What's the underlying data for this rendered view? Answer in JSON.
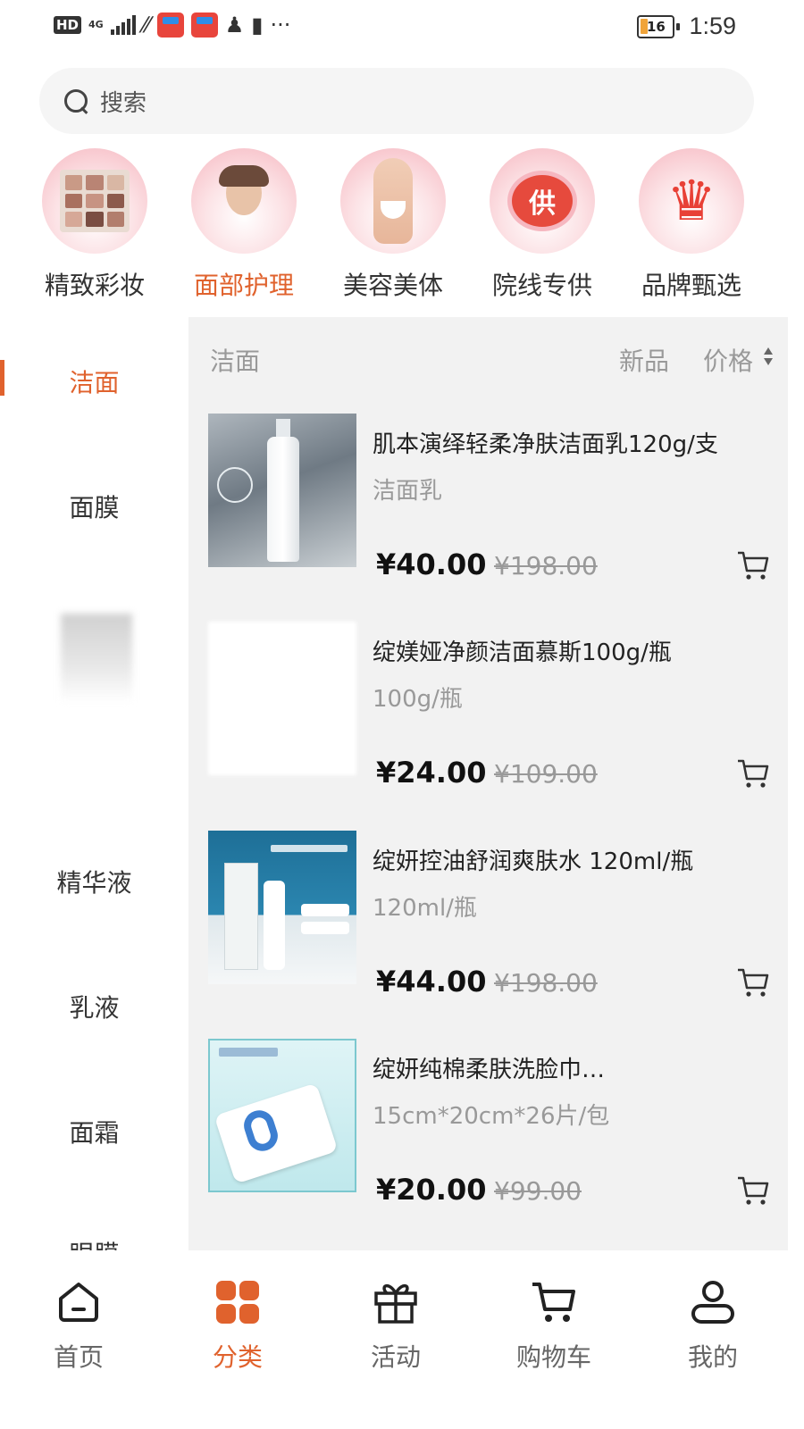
{
  "status_bar": {
    "hd": "HD",
    "network": "4G",
    "battery": "16",
    "time": "1:59",
    "more": "···"
  },
  "search": {
    "placeholder": "搜索"
  },
  "categories": [
    {
      "label": "精致彩妆",
      "icon": "eyeshadow-palette-icon",
      "active": false
    },
    {
      "label": "面部护理",
      "icon": "face-care-icon",
      "active": true
    },
    {
      "label": "美容美体",
      "icon": "body-care-icon",
      "active": false
    },
    {
      "label": "院线专供",
      "icon": "supply-badge-icon",
      "active": false
    },
    {
      "label": "品牌甄选",
      "icon": "crown-icon",
      "active": false
    }
  ],
  "supply_badge_text": "供",
  "left_nav": {
    "items": [
      "洁面",
      "面膜",
      "眼霜",
      "精华液",
      "乳液",
      "面霜",
      "眼膜"
    ],
    "active_index": 0
  },
  "filter": {
    "category": "洁面",
    "new_label": "新品",
    "price_label": "价格"
  },
  "products": [
    {
      "title": "肌本演绎轻柔净肤洁面乳120g/支",
      "spec": "洁面乳",
      "price": "¥40.00",
      "original_price": "¥198.00"
    },
    {
      "title": "绽媄娅净颜洁面慕斯100g/瓶",
      "spec": "100g/瓶",
      "price": "¥24.00",
      "original_price": "¥109.00"
    },
    {
      "title": "绽妍控油舒润爽肤水 120ml/瓶",
      "spec": "120ml/瓶",
      "price": "¥44.00",
      "original_price": "¥198.00"
    },
    {
      "title": "绽妍纯棉柔肤洗脸巾…",
      "spec": "15cm*20cm*26片/包",
      "price": "¥20.00",
      "original_price": "¥99.00"
    }
  ],
  "tabbar": {
    "items": [
      {
        "label": "首页",
        "icon": "home-icon",
        "active": false
      },
      {
        "label": "分类",
        "icon": "category-grid-icon",
        "active": true
      },
      {
        "label": "活动",
        "icon": "gift-icon",
        "active": false
      },
      {
        "label": "购物车",
        "icon": "cart-icon",
        "active": false
      },
      {
        "label": "我的",
        "icon": "profile-icon",
        "active": false
      }
    ]
  },
  "colors": {
    "accent": "#e0622d",
    "panel_bg": "#f2f2f2",
    "muted_text": "#999999"
  }
}
